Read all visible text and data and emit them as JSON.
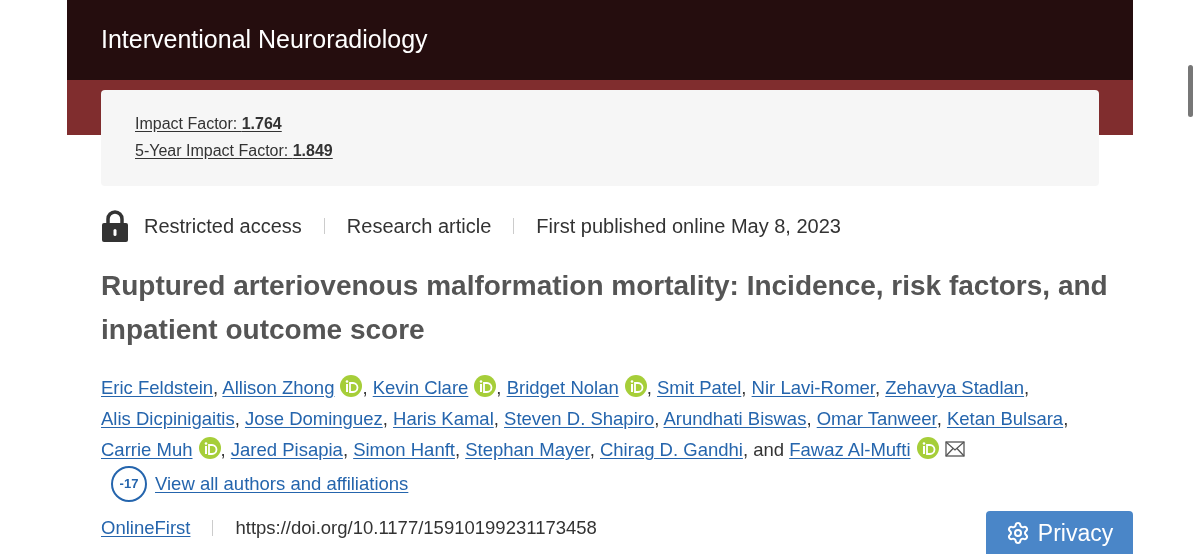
{
  "journal": {
    "title": "Interventional Neuroradiology"
  },
  "metrics": [
    {
      "label": "Impact Factor: ",
      "value": "1.764"
    },
    {
      "label": "5-Year Impact Factor: ",
      "value": "1.849"
    }
  ],
  "meta": {
    "access": "Restricted access",
    "type": "Research article",
    "published": "First published online May 8, 2023"
  },
  "article_title": "Ruptured arteriovenous malformation mortality: Incidence, risk factors, and inpatient outcome score",
  "authors": [
    {
      "name": "Eric Feldstein",
      "orcid": false,
      "email": false,
      "separator": ","
    },
    {
      "name": "Allison Zhong",
      "orcid": true,
      "email": false,
      "separator": ","
    },
    {
      "name": "Kevin Clare",
      "orcid": true,
      "email": false,
      "separator": ","
    },
    {
      "name": "Bridget Nolan",
      "orcid": true,
      "email": false,
      "separator": ","
    },
    {
      "name": "Smit Patel",
      "orcid": false,
      "email": false,
      "separator": ","
    },
    {
      "name": "Nir Lavi-Romer",
      "orcid": false,
      "email": false,
      "separator": ","
    },
    {
      "name": "Zehavya Stadlan",
      "orcid": false,
      "email": false,
      "separator": ","
    },
    {
      "name": "Alis Dicpinigaitis",
      "orcid": false,
      "email": false,
      "separator": ","
    },
    {
      "name": "Jose Dominguez",
      "orcid": false,
      "email": false,
      "separator": ","
    },
    {
      "name": "Haris Kamal",
      "orcid": false,
      "email": false,
      "separator": ","
    },
    {
      "name": "Steven D. Shapiro",
      "orcid": false,
      "email": false,
      "separator": ","
    },
    {
      "name": "Arundhati Biswas",
      "orcid": false,
      "email": false,
      "separator": ","
    },
    {
      "name": "Omar Tanweer",
      "orcid": false,
      "email": false,
      "separator": ","
    },
    {
      "name": "Ketan Bulsara",
      "orcid": false,
      "email": false,
      "separator": ","
    },
    {
      "name": "Carrie Muh",
      "orcid": true,
      "email": false,
      "separator": ","
    },
    {
      "name": "Jared Pisapia",
      "orcid": false,
      "email": false,
      "separator": ","
    },
    {
      "name": "Simon Hanft",
      "orcid": false,
      "email": false,
      "separator": ","
    },
    {
      "name": "Stephan Mayer",
      "orcid": false,
      "email": false,
      "separator": ","
    },
    {
      "name": "Chirag D. Gandhi",
      "orcid": false,
      "email": false,
      "separator": ","
    },
    {
      "name": "Fawaz Al-Mufti",
      "orcid": true,
      "email": true
    }
  ],
  "authors_conjunction": "and",
  "view_all": {
    "badge": "-17",
    "label": "View all authors and affiliations"
  },
  "footer": {
    "issue": "OnlineFirst",
    "doi": "https://doi.org/10.1177/15910199231173458"
  },
  "privacy_button": {
    "label": "Privacy"
  }
}
